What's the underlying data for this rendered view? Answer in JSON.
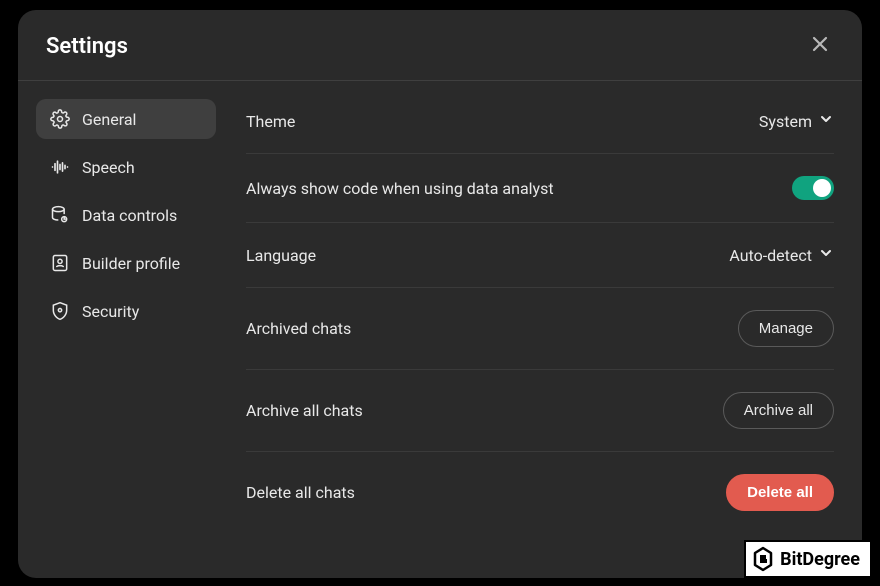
{
  "header": {
    "title": "Settings"
  },
  "sidebar": {
    "items": [
      {
        "label": "General",
        "active": true
      },
      {
        "label": "Speech",
        "active": false
      },
      {
        "label": "Data controls",
        "active": false
      },
      {
        "label": "Builder profile",
        "active": false
      },
      {
        "label": "Security",
        "active": false
      }
    ]
  },
  "settings": {
    "theme": {
      "label": "Theme",
      "value": "System"
    },
    "code": {
      "label": "Always show code when using data analyst",
      "enabled": true
    },
    "language": {
      "label": "Language",
      "value": "Auto-detect"
    },
    "archived": {
      "label": "Archived chats",
      "button": "Manage"
    },
    "archive_all": {
      "label": "Archive all chats",
      "button": "Archive all"
    },
    "delete_all": {
      "label": "Delete all chats",
      "button": "Delete all"
    }
  },
  "watermark": {
    "text": "BitDegree"
  }
}
